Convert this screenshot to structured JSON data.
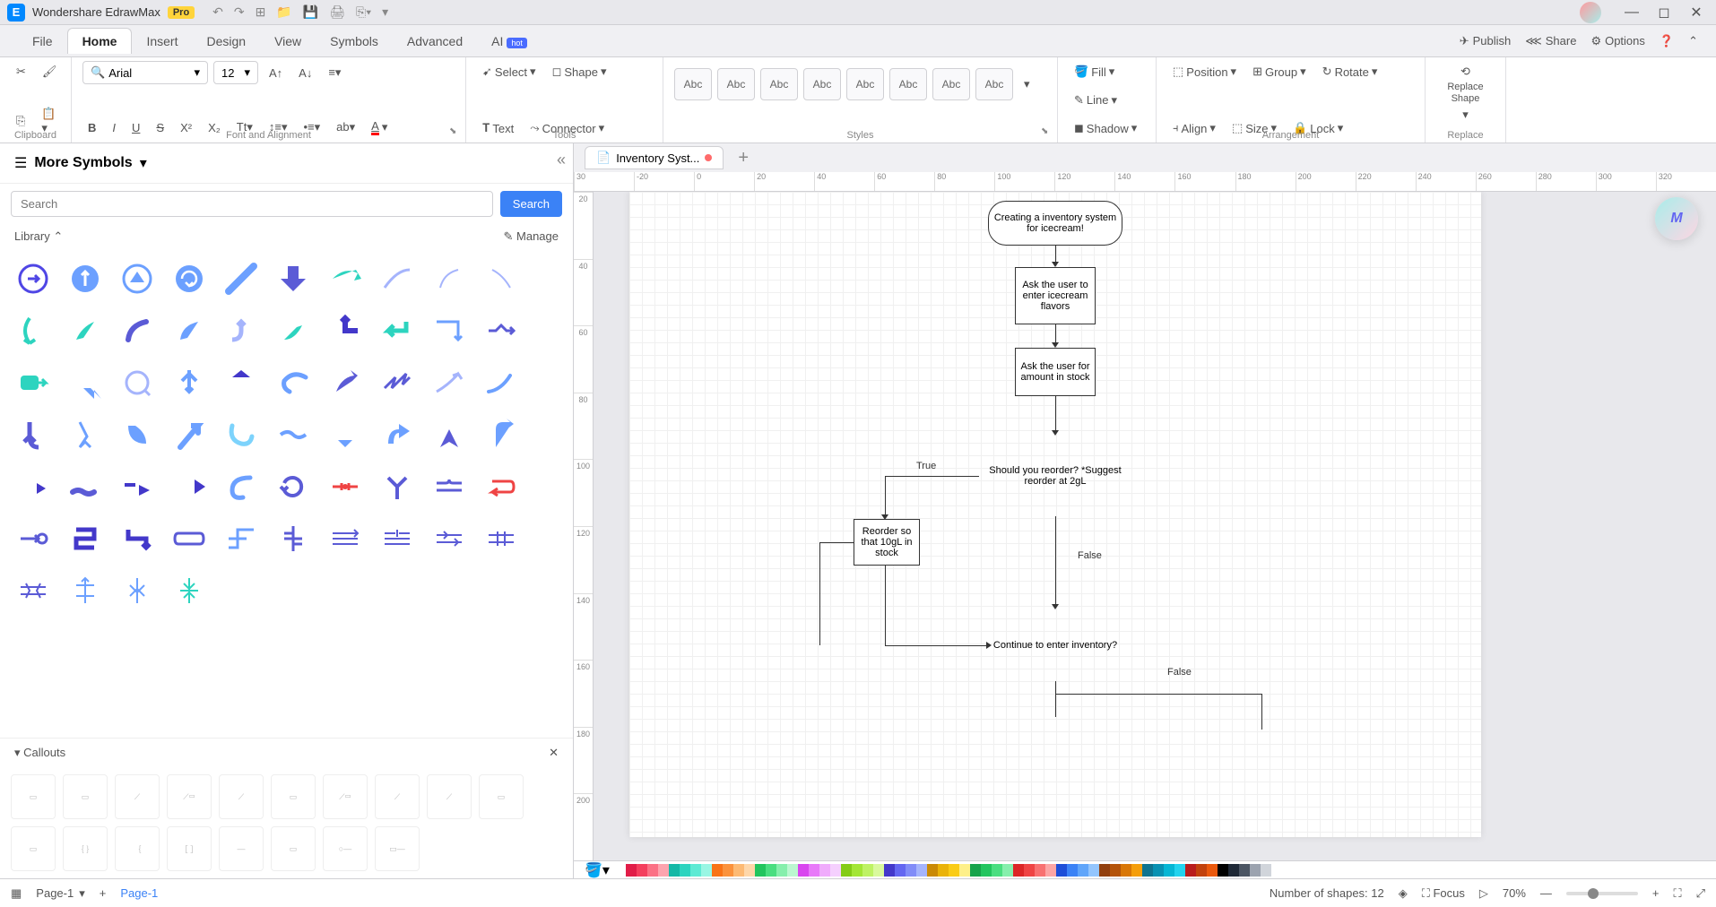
{
  "app": {
    "title": "Wondershare EdrawMax",
    "badge": "Pro"
  },
  "menu": {
    "tabs": [
      "File",
      "Home",
      "Insert",
      "Design",
      "View",
      "Symbols",
      "Advanced",
      "AI"
    ],
    "active": 1,
    "hot": "hot",
    "right": {
      "publish": "Publish",
      "share": "Share",
      "options": "Options"
    }
  },
  "ribbon": {
    "clipboard_label": "Clipboard",
    "font_label": "Font and Alignment",
    "tools_label": "Tools",
    "styles_label": "Styles",
    "arrangement_label": "Arrangement",
    "replace_label": "Replace",
    "font_name": "Arial",
    "font_size": "12",
    "select": "Select",
    "shape": "Shape",
    "text": "Text",
    "connector": "Connector",
    "style_swatch": "Abc",
    "fill": "Fill",
    "line": "Line",
    "shadow": "Shadow",
    "position": "Position",
    "align": "Align",
    "group": "Group",
    "size": "Size",
    "rotate": "Rotate",
    "lock": "Lock",
    "replace_shape": "Replace Shape"
  },
  "left": {
    "title": "More Symbols",
    "search_placeholder": "Search",
    "search_btn": "Search",
    "library": "Library",
    "manage": "Manage",
    "callouts": "Callouts"
  },
  "doc": {
    "tab_name": "Inventory Syst..."
  },
  "ruler_h": [
    "30",
    "-20",
    "0",
    "20",
    "40",
    "60",
    "80",
    "100",
    "120",
    "140",
    "160",
    "180",
    "200",
    "220",
    "240",
    "260",
    "280",
    "300",
    "320"
  ],
  "ruler_v": [
    "20",
    "40",
    "60",
    "80",
    "100",
    "120",
    "140",
    "160",
    "180",
    "200"
  ],
  "flowchart": {
    "n1": "Creating a inventory system for icecream!",
    "n2": "Ask the user to enter icecream flavors",
    "n3": "Ask the user for amount in stock",
    "n4": "Should you reorder? *Suggest reorder at 2gL",
    "n5": "Reorder so that 10gL in stock",
    "n6": "Continue to enter inventory?",
    "true_label": "True",
    "false_label": "False",
    "false_label2": "False"
  },
  "status": {
    "page_sel": "Page-1",
    "page_tab": "Page-1",
    "shapes": "Number of shapes: 12",
    "focus": "Focus",
    "zoom": "70%"
  },
  "colors": [
    "#ffffff",
    "#e11d48",
    "#f43f5e",
    "#fb7185",
    "#fda4af",
    "#14b8a6",
    "#2dd4bf",
    "#5eead4",
    "#99f6e4",
    "#f97316",
    "#fb923c",
    "#fdba74",
    "#fed7aa",
    "#22c55e",
    "#4ade80",
    "#86efac",
    "#bbf7d0",
    "#d946ef",
    "#e879f9",
    "#f0abfc",
    "#f5d0fe",
    "#84cc16",
    "#a3e635",
    "#bef264",
    "#d9f99d",
    "#4338ca",
    "#6366f1",
    "#818cf8",
    "#a5b4fc",
    "#ca8a04",
    "#eab308",
    "#facc15",
    "#fef08a",
    "#16a34a",
    "#22c55e",
    "#4ade80",
    "#86efac",
    "#dc2626",
    "#ef4444",
    "#f87171",
    "#fca5a5",
    "#1d4ed8",
    "#3b82f6",
    "#60a5fa",
    "#93c5fd",
    "#92400e",
    "#b45309",
    "#d97706",
    "#f59e0b",
    "#0e7490",
    "#0891b2",
    "#06b6d4",
    "#22d3ee",
    "#b91c1c",
    "#c2410c",
    "#ea580c",
    "#000000",
    "#1f2937",
    "#4b5563",
    "#9ca3af",
    "#d1d5db"
  ],
  "ai_badge": "M"
}
